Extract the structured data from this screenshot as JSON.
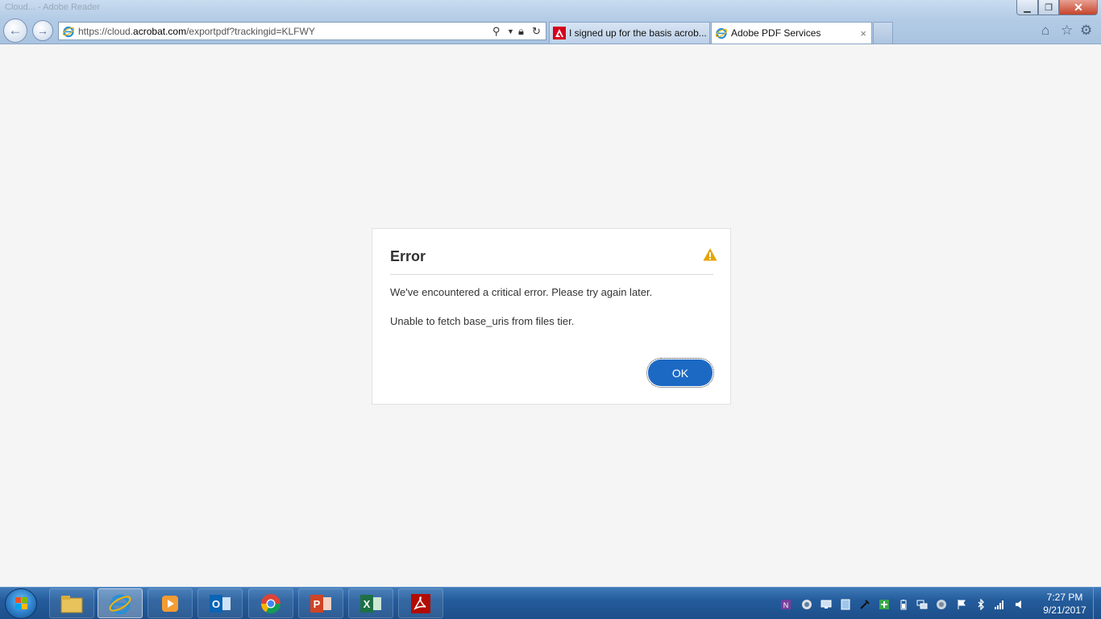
{
  "window": {
    "title": "Cloud... - Adobe Reader"
  },
  "browser": {
    "url_prefix": "https://cloud.",
    "url_domain": "acrobat.com",
    "url_path": "/exportpdf?trackingid=KLFWY",
    "tabs": [
      {
        "label": "I signed up for the basis acrob...",
        "icon": "adobe-icon",
        "active": false
      },
      {
        "label": "Adobe PDF Services",
        "icon": "ie-icon",
        "active": true
      }
    ],
    "tab_close": "×"
  },
  "dialog": {
    "title": "Error",
    "message": "We've encountered a critical error. Please try again later.",
    "detail": "Unable to fetch base_uris from files tier.",
    "ok_label": "OK",
    "warning_color": "#e6a400",
    "ok_color": "#1c69c4"
  },
  "taskbar": {
    "apps": [
      "file-explorer-icon",
      "internet-explorer-icon",
      "media-player-icon",
      "outlook-icon",
      "chrome-icon",
      "powerpoint-icon",
      "excel-icon",
      "adobe-reader-icon"
    ],
    "time": "7:27 PM",
    "date": "9/21/2017"
  }
}
